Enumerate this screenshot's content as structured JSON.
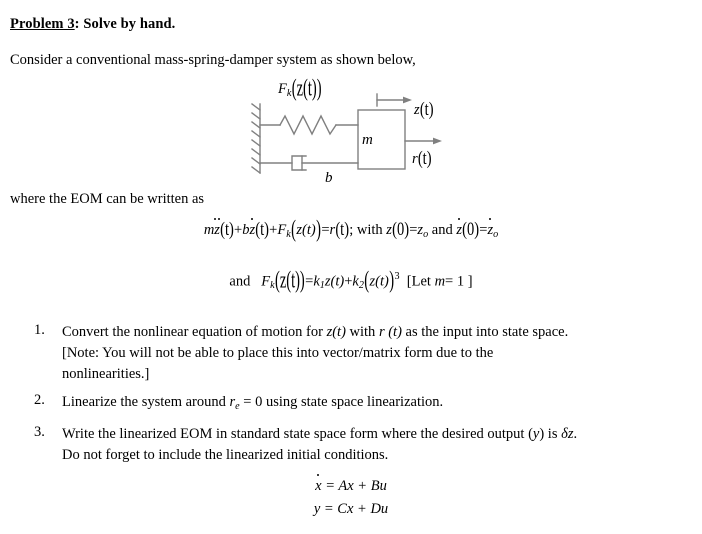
{
  "heading": {
    "underlined": "Problem 3",
    "rest": ": Solve by hand."
  },
  "intro": "Consider a conventional mass-spring-damper system as shown below,",
  "where_line": "where the EOM can be written as",
  "diagram": {
    "spring_force_label": "F",
    "spring_force_sub": "k",
    "spring_force_arg": "(z(t))",
    "mass_label": "m",
    "damper_label": "b",
    "output_label": "z",
    "output_arg": "(t)",
    "input_label": "r",
    "input_arg": "(t)"
  },
  "equations": {
    "eom": {
      "m": "m",
      "z_ddot": "z",
      "t1": "(t)",
      "plus1": "+",
      "b": "b",
      "z_dot": "z",
      "t2": "(t)",
      "plus2": "+",
      "F": "F",
      "F_sub": "k",
      "fk_open": "(",
      "fk_inner": "z(t)",
      "fk_close": ")",
      "eq": "=",
      "r": "r",
      "t3": "(t)",
      "semi": ";",
      "with": "with",
      "z0": "z",
      "z0_arg": "(0)",
      "eq2": "=",
      "z_init": "z",
      "z_init_sub": "o",
      "and": "and",
      "zd0": "z",
      "zd0_arg": "(0)",
      "eq3": "=",
      "zd_init": "z",
      "zd_init_sub": "o"
    },
    "fk": {
      "and": "and",
      "F": "F",
      "F_sub": "k",
      "arg": "(z(t))",
      "eq": "=",
      "k1": "k",
      "k1_sub": "1",
      "z1": "z(t)",
      "plus": "+",
      "k2": "k",
      "k2_sub": "2",
      "open": "(",
      "z2": "z(t)",
      "close": ")",
      "power": "3",
      "note_open": "[Let",
      "note_m": "m",
      "note_eq": "= 1",
      "note_close": "]"
    },
    "state_space_1": {
      "lhs": "x",
      "rhs": "= Ax + Bu"
    },
    "state_space_2": {
      "lhs": "y",
      "rhs": "= Cx + Du"
    }
  },
  "questions": [
    {
      "number": "1.",
      "line1_a": "Convert the nonlinear equation of motion for ",
      "line1_z": "z(t)",
      "line1_b": " with ",
      "line1_r": "r (t)",
      "line1_c": " as the input into state space.",
      "line2": "[Note: You will not be able to place this into vector/matrix form due to the",
      "line3": "nonlinearities.]"
    },
    {
      "number": "2.",
      "line1_a": "Linearize the system around ",
      "line1_sym": "r",
      "line1_sub": "e",
      "line1_eq": " = 0",
      "line1_b": " using state space linearization."
    },
    {
      "number": "3.",
      "line1_a": "Write the linearized EOM in standard state space form where the desired output (",
      "line1_y": "y",
      "line1_b": ") is ",
      "line1_dz": "δz",
      "line1_c": ".",
      "line2": "Do not forget to include the linearized initial conditions."
    }
  ],
  "colors": {
    "text": "#000000",
    "diagram_line": "#808080",
    "background": "#ffffff"
  }
}
